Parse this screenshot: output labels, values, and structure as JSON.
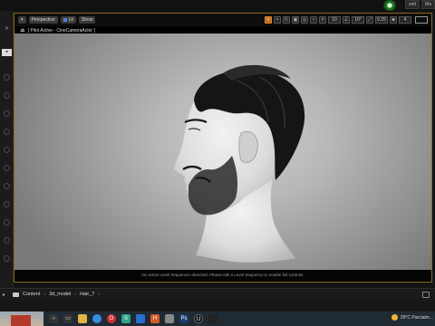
{
  "topbar": {
    "right_labels": [
      "sett",
      "Ma"
    ]
  },
  "viewport": {
    "view_mode": "Perspective",
    "lit_label": "Lit",
    "show_label": "Show",
    "pilot_text": "[ Pilot Active - CineCameraActor ]",
    "grid_value": "10",
    "angle_value": "10°",
    "speed_value": "4",
    "message": "No active Level Sequencer detected. Please edit a Level Sequence to enable full controls."
  },
  "content_browser": {
    "breadcrumbs": [
      "Content",
      "3d_model",
      "Hair_7"
    ]
  },
  "taskbar": {
    "weather": "29°C  Parcialm...",
    "apps": [
      {
        "name": "search",
        "color": "#333"
      },
      {
        "name": "task-view",
        "color": "#333"
      },
      {
        "name": "file-explorer",
        "color": "#e3b341"
      },
      {
        "name": "chrome",
        "color": "#3a8de0"
      },
      {
        "name": "opera",
        "color": "#d0312d"
      },
      {
        "name": "app-s",
        "color": "#2ea58a"
      },
      {
        "name": "app-blue",
        "color": "#2b6fd1"
      },
      {
        "name": "app-h",
        "color": "#d25a2a"
      },
      {
        "name": "app-clip",
        "color": "#888"
      },
      {
        "name": "app-ps",
        "color": "#1b3b6f"
      },
      {
        "name": "unreal",
        "color": "#111"
      },
      {
        "name": "app-dark",
        "color": "#222"
      }
    ]
  }
}
